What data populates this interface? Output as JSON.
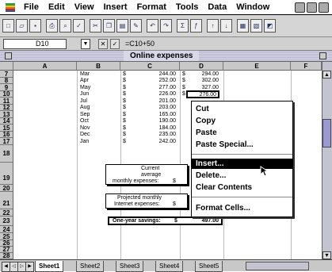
{
  "menubar": {
    "items": [
      "File",
      "Edit",
      "View",
      "Insert",
      "Format",
      "Tools",
      "Data",
      "Window"
    ]
  },
  "formula_bar": {
    "cell_ref": "D10",
    "formula": "=C10+50"
  },
  "window": {
    "title": "Online expenses"
  },
  "columns": [
    "A",
    "B",
    "C",
    "D",
    "E",
    "F"
  ],
  "rows": [
    "7",
    "8",
    "9",
    "10",
    "11",
    "12",
    "13",
    "14",
    "15",
    "16",
    "17",
    "18",
    "19",
    "20",
    "21",
    "22",
    "23",
    "24",
    "25",
    "26",
    "27",
    "28"
  ],
  "data_rows": [
    {
      "month": "Mar",
      "c": "244.00",
      "d": "294.00"
    },
    {
      "month": "Apr",
      "c": "252.00",
      "d": "302.00"
    },
    {
      "month": "May",
      "c": "277.00",
      "d": "327.00"
    },
    {
      "month": "Jun",
      "c": "226.00",
      "d": "276.00"
    },
    {
      "month": "Jul",
      "c": "201.00",
      "d": ""
    },
    {
      "month": "Aug",
      "c": "203.00",
      "d": ""
    },
    {
      "month": "Sep",
      "c": "165.00",
      "d": ""
    },
    {
      "month": "Oct",
      "c": "190.00",
      "d": ""
    },
    {
      "month": "Nov",
      "c": "184.00",
      "d": ""
    },
    {
      "month": "Dec",
      "c": "235.00",
      "d": ""
    },
    {
      "month": "Jan",
      "c": "242.00",
      "d": ""
    }
  ],
  "currency_symbol": "$",
  "summary": {
    "current_avg_line1": "Current",
    "current_avg_line2": "average",
    "current_avg_line3": "monthly expenses:",
    "current_avg_symbol": "$",
    "projected_line1": "Projected monthly",
    "projected_line2": "Internet expenses:",
    "projected_symbol": "$",
    "savings_label": "One-year savings:",
    "savings_symbol": "$",
    "savings_value": "497.00"
  },
  "context_menu": {
    "items": [
      "Cut",
      "Copy",
      "Paste",
      "Paste Special...",
      "Insert...",
      "Delete...",
      "Clear Contents",
      "Format Cells..."
    ],
    "selected": "Insert..."
  },
  "sheet_tabs": [
    "Sheet1",
    "Sheet2",
    "Sheet3",
    "Sheet4",
    "Sheet5"
  ],
  "active_sheet": "Sheet1",
  "colors": {
    "accent": "#9a9ad0",
    "selected_bg": "#000000"
  }
}
